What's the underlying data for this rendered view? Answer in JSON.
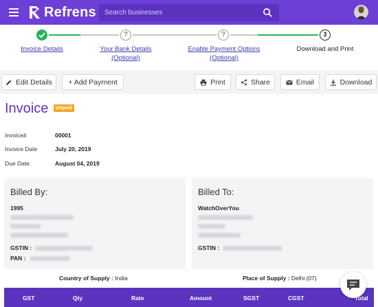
{
  "header": {
    "logo_text": "Refrens",
    "search_placeholder": "Search businesses"
  },
  "stepper": {
    "steps": [
      {
        "label": "Invoice Details",
        "sub": "",
        "state": "done"
      },
      {
        "label": "Your Bank Details",
        "sub": "(Optional)",
        "state": "pending"
      },
      {
        "label": "Enable Payment Options",
        "sub": "(Optional)",
        "state": "pending"
      },
      {
        "label": "Download and Print",
        "sub": "",
        "state": "current",
        "number": "3"
      }
    ],
    "pending_glyph": "?"
  },
  "actions": {
    "edit": "Edit Details",
    "add_payment": "+ Add Payment",
    "print": "Print",
    "share": "Share",
    "email": "Email",
    "download": "Download"
  },
  "invoice": {
    "title": "Invoice",
    "status": "Unpaid",
    "meta": [
      {
        "label": "Invoice#",
        "value": "00001"
      },
      {
        "label": "Invoice Date",
        "value": "July 20, 2019"
      },
      {
        "label": "Due Date",
        "value": "August 04, 2019"
      }
    ]
  },
  "billed_by": {
    "title": "Billed By:",
    "name": "1995",
    "gstin_label": "GSTIN :",
    "pan_label": "PAN :"
  },
  "billed_to": {
    "title": "Billed To:",
    "name": "WatchOverYou",
    "gstin_label": "GSTIN :"
  },
  "supply": {
    "country_label": "Country of Supply :",
    "country_value": "India",
    "place_label": "Place of Supply :",
    "place_value": "Delhi (07)"
  },
  "table": {
    "columns": [
      "GST",
      "Qty",
      "Rate",
      "Amount",
      "SGST",
      "CGST",
      "Total"
    ]
  },
  "colors": {
    "brand": "#6c3fd6",
    "brand_dark": "#5a33bf",
    "success": "#25b35a",
    "badge": "#f5a623"
  }
}
